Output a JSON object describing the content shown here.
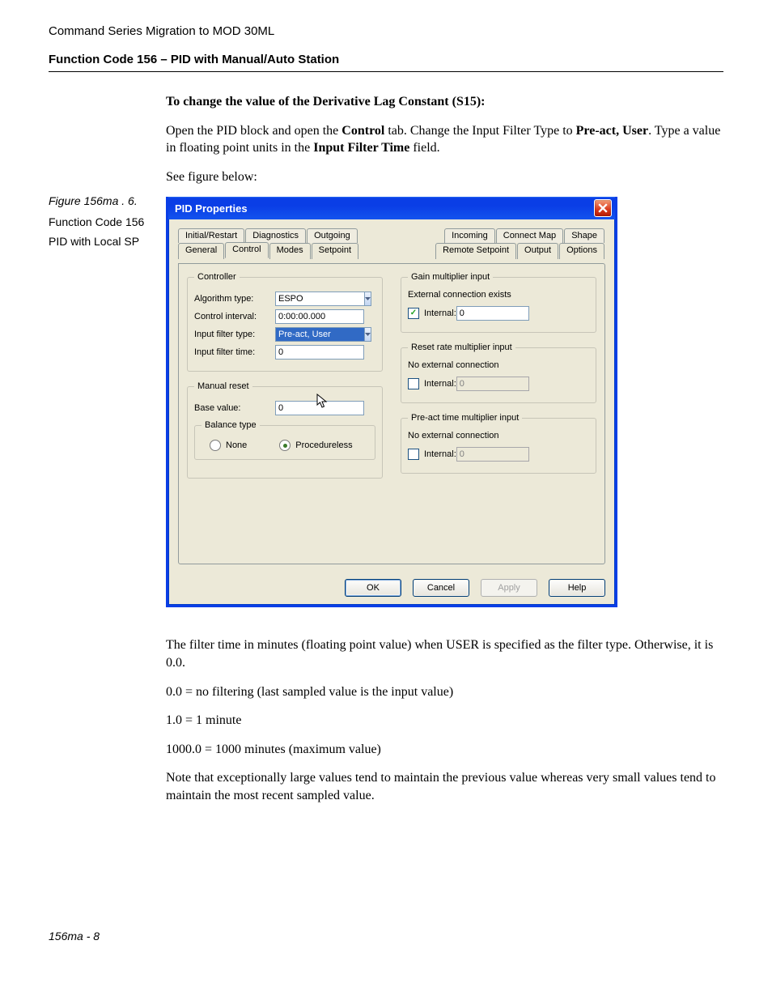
{
  "doc": {
    "header": "Command Series Migration to MOD 30ML",
    "section": "Function Code 156 – PID with Manual/Auto Station",
    "heading": "To change the value of the Derivative Lag Constant (S15):",
    "intro_plain1": "Open the PID block and open the ",
    "intro_bold1": "Control",
    "intro_plain2": " tab. Change the Input Filter Type to ",
    "intro_bold2": "Pre-act, User",
    "intro_plain3": ". Type a value in floating point units in the ",
    "intro_bold3": "Input Filter Time",
    "intro_plain4": " field.",
    "see_figure": "See figure below:",
    "after_fig1": "The filter time in minutes (floating point value) when USER is specified as the filter type. Otherwise, it is 0.0.",
    "after_fig2": "0.0 = no filtering (last sampled value is the input value)",
    "after_fig3": "1.0 = 1 minute",
    "after_fig4": "1000.0 = 1000 minutes (maximum value)",
    "after_fig5": "Note that exceptionally large values tend to maintain the previous value whereas very small values tend to maintain the most recent sampled value.",
    "footer": "156ma - 8"
  },
  "sidebar": {
    "fig": "Figure 156ma . 6.",
    "line1": "Function Code 156",
    "line2": "PID with Local SP"
  },
  "dialog": {
    "title": "PID Properties",
    "tabs_back_left": [
      "Initial/Restart",
      "Diagnostics",
      "Outgoing"
    ],
    "tabs_back_right": [
      "Incoming",
      "Connect Map",
      "Shape"
    ],
    "tabs_front_left": [
      "General",
      "Control",
      "Modes",
      "Setpoint"
    ],
    "tabs_front_right": [
      "Remote Setpoint",
      "Output",
      "Options"
    ],
    "controller": {
      "legend": "Controller",
      "algo_label": "Algorithm type:",
      "algo_value": "ESPO",
      "interval_label": "Control interval:",
      "interval_value": "0:00:00.000",
      "filter_type_label": "Input filter type:",
      "filter_type_value": "Pre-act, User",
      "filter_time_label": "Input filter time:",
      "filter_time_value": "0"
    },
    "manual_reset": {
      "legend": "Manual reset",
      "base_label": "Base value:",
      "base_value": "0",
      "balance_legend": "Balance type",
      "opt_none": "None",
      "opt_proc": "Procedureless"
    },
    "gain": {
      "legend": "Gain multiplier input",
      "status": "External connection exists",
      "internal_label": "Internal:",
      "internal_value": "0"
    },
    "reset": {
      "legend": "Reset rate multiplier input",
      "status": "No external connection",
      "internal_label": "Internal:",
      "internal_value": "0"
    },
    "preact": {
      "legend": "Pre-act time multiplier input",
      "status": "No external connection",
      "internal_label": "Internal:",
      "internal_value": "0"
    },
    "buttons": {
      "ok": "OK",
      "cancel": "Cancel",
      "apply": "Apply",
      "help": "Help"
    }
  }
}
